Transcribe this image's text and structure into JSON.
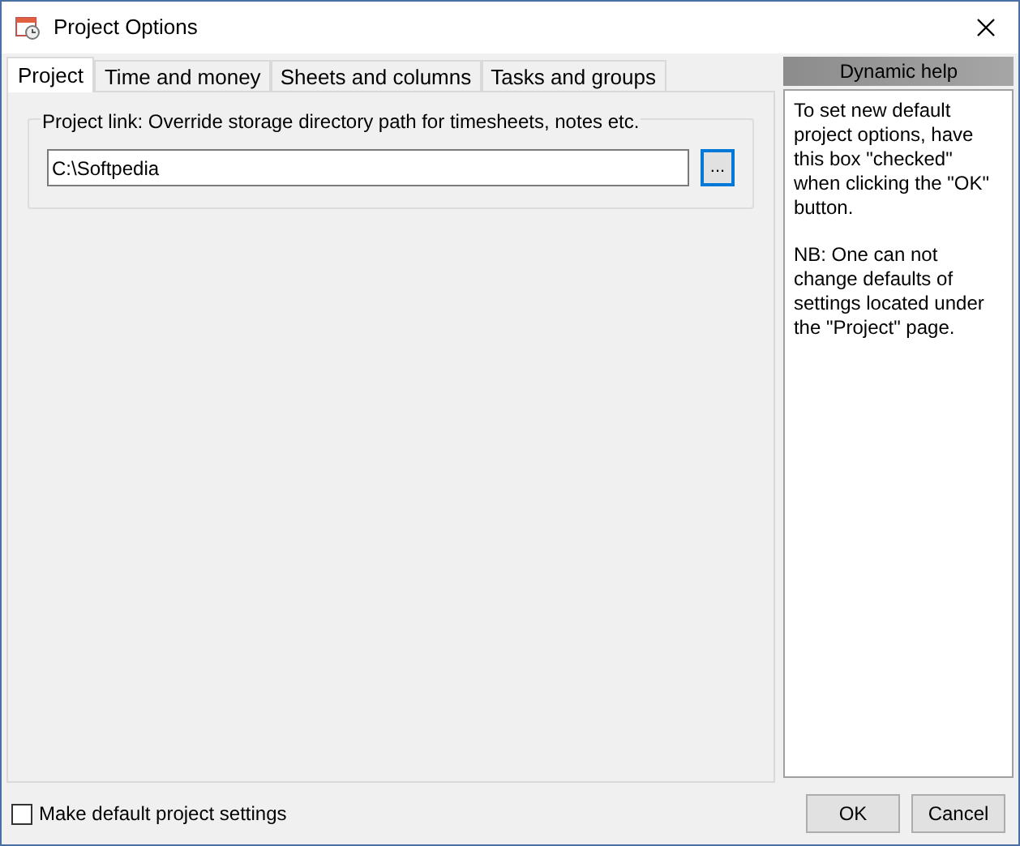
{
  "window": {
    "title": "Project Options"
  },
  "tabs": [
    {
      "label": "Project",
      "selected": true
    },
    {
      "label": "Time and money",
      "selected": false
    },
    {
      "label": "Sheets and columns",
      "selected": false
    },
    {
      "label": "Tasks and groups",
      "selected": false
    }
  ],
  "project_link": {
    "legend": "Project link: Override storage directory path for timesheets, notes etc.",
    "value": "C:\\Softpedia",
    "browse": "..."
  },
  "help": {
    "title": "Dynamic help",
    "paragraphs": [
      "To set new default project options, have this box \"checked\" when clicking the \"OK\" button.",
      "NB: One can not change defaults of settings located under the \"Project\" page."
    ]
  },
  "footer": {
    "checkbox": {
      "label": "Make default project settings",
      "checked": false
    },
    "buttons": [
      "OK",
      "Cancel"
    ]
  }
}
